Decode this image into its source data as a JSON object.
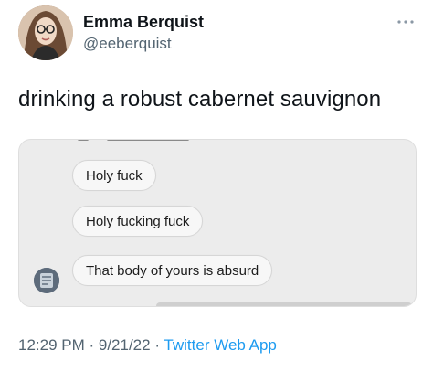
{
  "author": {
    "display_name": "Emma Berquist",
    "handle": "@eeberquist",
    "avatar_icon": "profile-photo"
  },
  "tweet": {
    "text": "drinking a robust cabernet sauvignon"
  },
  "media": {
    "messages": [
      "Holy fuck",
      "Holy fucking fuck",
      "That body of yours is absurd"
    ]
  },
  "meta": {
    "time": "12:29 PM",
    "separator1": " · ",
    "date": "9/21/22",
    "separator2": " · ",
    "source": "Twitter Web App"
  },
  "colors": {
    "accent": "#1d9bf0",
    "secondary_text": "#536471",
    "primary_text": "#0f1419"
  }
}
